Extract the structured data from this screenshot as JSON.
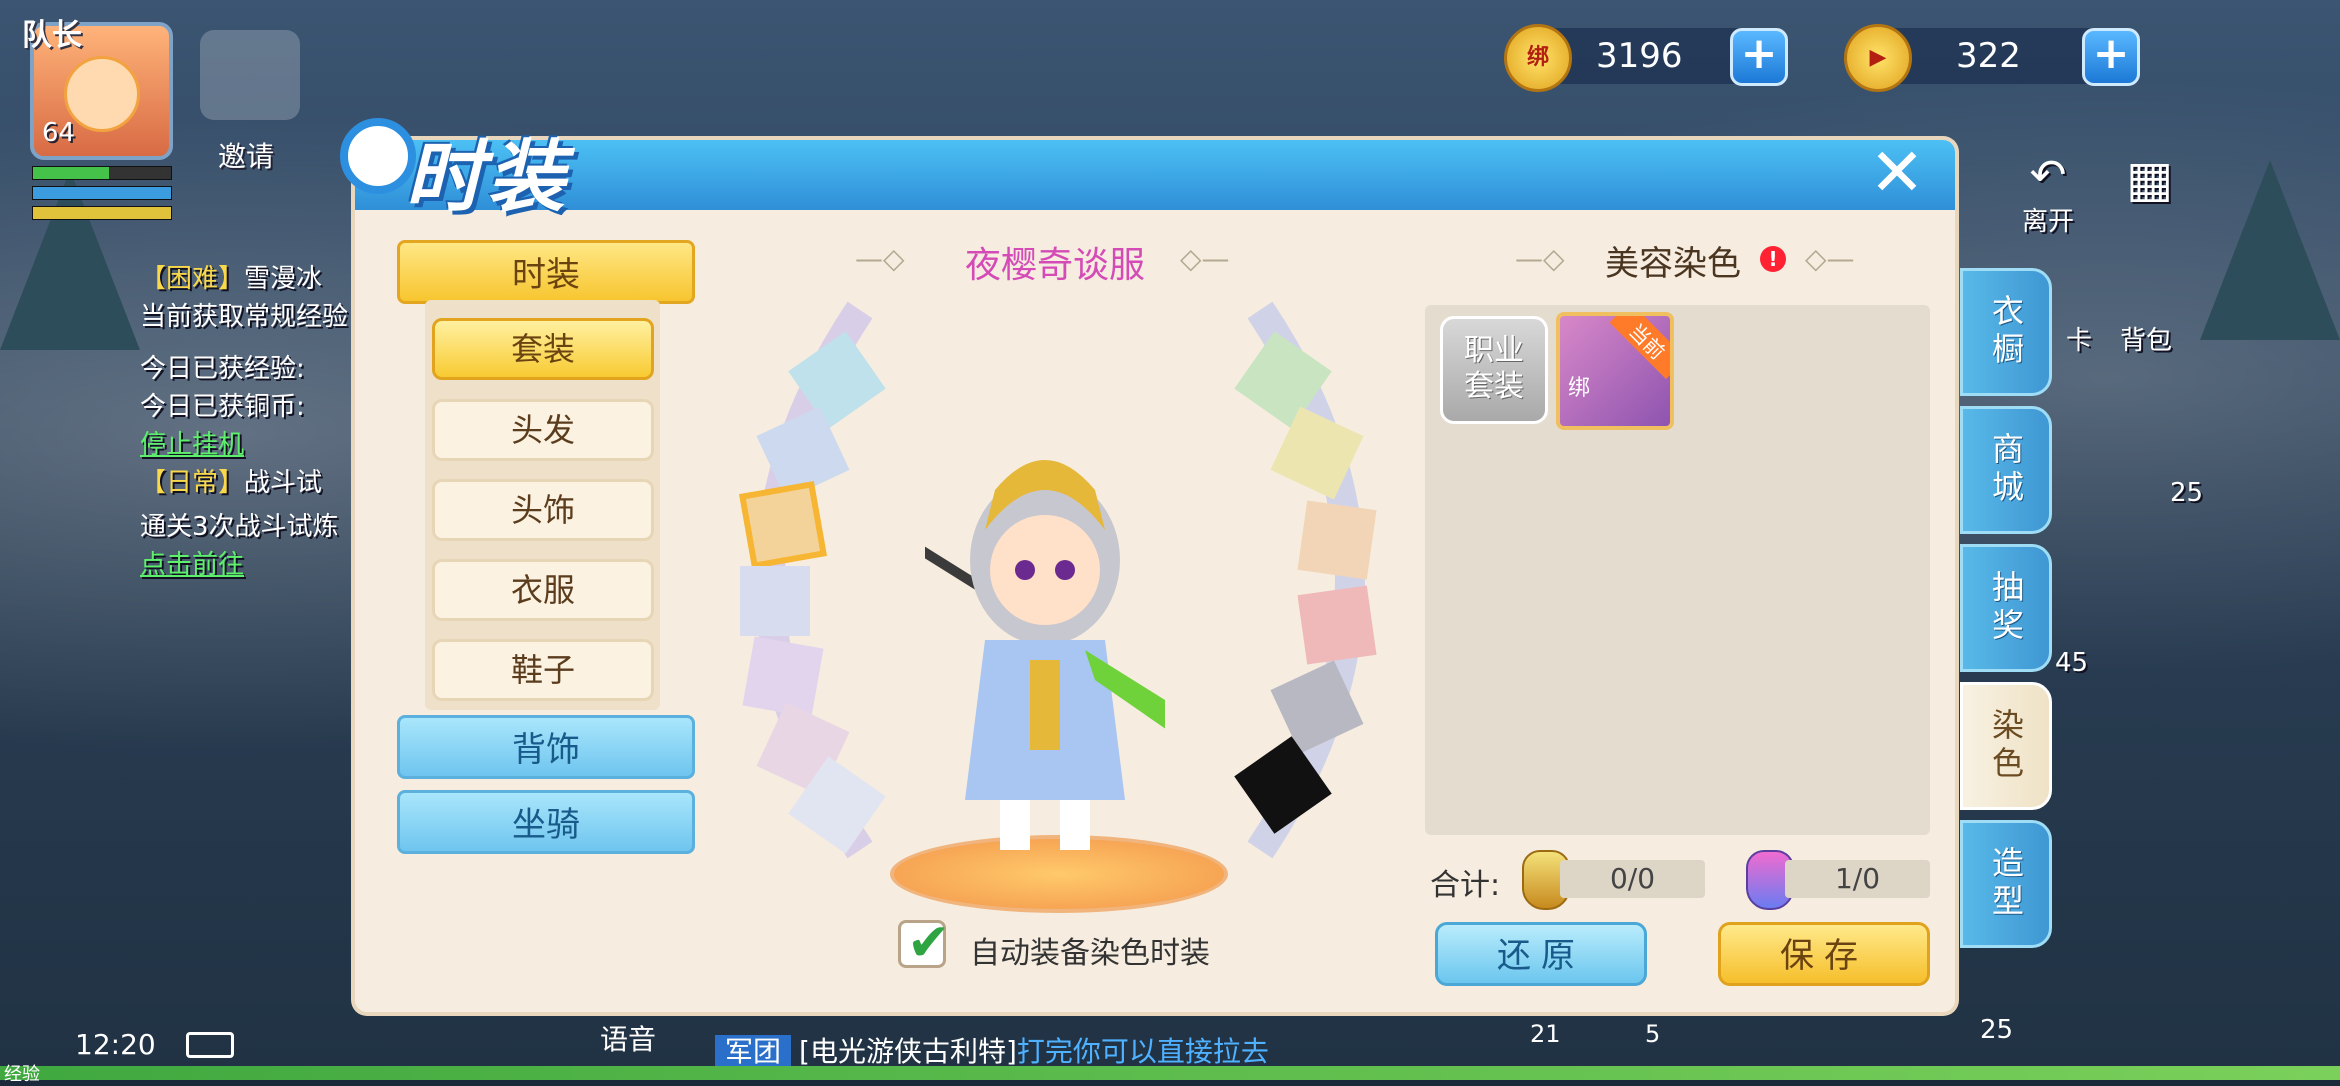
{
  "hud": {
    "captain_label": "队长",
    "level": "64",
    "invite_label": "邀请",
    "clock": "12:20",
    "voice_label": "语音",
    "exp_label": "经验"
  },
  "chat": {
    "line1_tag": "【困难】",
    "line1_text": "雪漫冰",
    "line2": "当前获取常规经验",
    "line3": "今日已获经验:",
    "line4": "今日已获铜币:",
    "line5": "停止挂机",
    "line6_tag": "【日常】",
    "line6_text": "战斗试",
    "line7": "通关3次战斗试炼",
    "line8": "点击前往"
  },
  "bottom_chat": {
    "channel": "军团",
    "name": "[电光游侠古利特]",
    "message": "打完你可以直接拉去"
  },
  "currency": {
    "bound_amount": "3196",
    "bound_glyph": "绑",
    "diamond_amount": "322"
  },
  "right_hud": {
    "leave": "离开",
    "bag": "背包",
    "card": "卡",
    "num_25_top": "25",
    "num_45": "45",
    "num_25_bottom": "25",
    "num_21": "21",
    "num_5": "5"
  },
  "right_tabs": [
    {
      "label": "衣橱",
      "active": false
    },
    {
      "label": "商城",
      "active": false
    },
    {
      "label": "抽奖",
      "active": false
    },
    {
      "label": "染色",
      "active": true
    },
    {
      "label": "造型",
      "active": false
    }
  ],
  "panel": {
    "title": "时装",
    "close": "✕"
  },
  "left_menu": {
    "categories": [
      "时装",
      "背饰",
      "坐骑"
    ],
    "subitems": [
      "套装",
      "头发",
      "头饰",
      "衣服",
      "鞋子"
    ],
    "active_sub": "套装"
  },
  "center": {
    "outfit_name": "夜樱奇谈服",
    "auto_equip_label": "自动装备染色时装",
    "auto_equip_checked": true
  },
  "dye": {
    "title": "美容染色",
    "alert": "!",
    "slot1_line1": "职业",
    "slot1_line2": "套装",
    "slot2_badge": "当前",
    "slot2_bind": "绑",
    "total_label": "合计:",
    "count1": "0/0",
    "count2": "1/0",
    "restore_button": "还原",
    "save_button": "保存"
  },
  "colors": {
    "left_ring": [
      "#bfe1ec",
      "#cdd9ef",
      "#f4d39a",
      "#d8dcef",
      "#e3d4ee",
      "#e9d6e4",
      "#e1e4f1"
    ],
    "right_ring": [
      "#c9e4c1",
      "#ece5b0",
      "#f1d5b6",
      "#f0b9b9",
      "#b8b8c2",
      "#111111"
    ]
  }
}
